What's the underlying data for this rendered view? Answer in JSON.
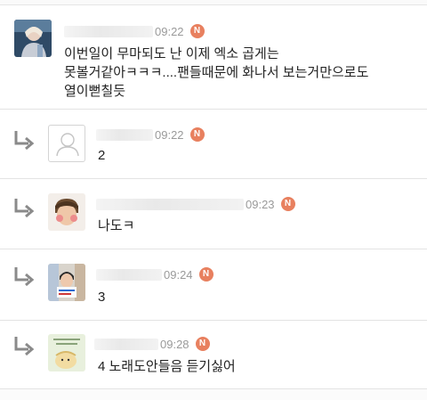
{
  "comments": [
    {
      "time": "09:22",
      "badge": "N",
      "avatar": "photo-avatar",
      "lines": [
        "이번일이 무마되도 난 이제 엑소 곱게는",
        "못볼거같아ㅋㅋㅋ....팬들때문에 화나서 보는거만으로도",
        "열이뻗칠듯"
      ]
    },
    {
      "time": "09:22",
      "badge": "N",
      "avatar": "default-user-icon",
      "text": "2"
    },
    {
      "time": "09:23",
      "badge": "N",
      "avatar": "photo-avatar",
      "text": "나도ㅋ"
    },
    {
      "time": "09:24",
      "badge": "N",
      "avatar": "photo-avatar",
      "text": "3"
    },
    {
      "time": "09:28",
      "badge": "N",
      "avatar": "photo-avatar",
      "text": "4 노래도안들음 듣기싫어"
    }
  ],
  "colors": {
    "badge": "#e8805f",
    "time": "#9a9a9a",
    "divider": "#e3e3e3",
    "reply_arrow": "#8a8a8a"
  }
}
